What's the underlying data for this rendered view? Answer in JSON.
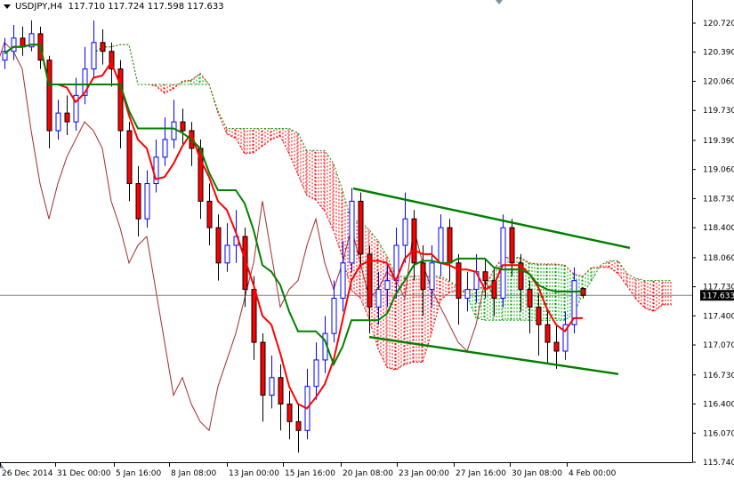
{
  "header": {
    "symbol": "USDJPY,H4",
    "ohlc_text": "117.710 117.724 117.598 117.633"
  },
  "chart_data": {
    "type": "candlestick",
    "title": "USDJPY,H4",
    "current_price": 117.633,
    "current_price_label": "117.633",
    "ylim": [
      115.74,
      120.72
    ],
    "y_ticks": [
      "120.720",
      "120.390",
      "120.060",
      "119.730",
      "119.390",
      "119.060",
      "118.730",
      "118.400",
      "118.060",
      "117.730",
      "117.400",
      "117.070",
      "116.730",
      "116.400",
      "116.070",
      "115.740"
    ],
    "x_ticks": [
      "26 Dec 2014",
      "31 Dec 00:00",
      "5 Jan 16:00",
      "8 Jan 08:00",
      "13 Jan 00:00",
      "15 Jan 16:00",
      "20 Jan 08:00",
      "23 Jan 00:00",
      "27 Jan 16:00",
      "30 Jan 08:00",
      "4 Feb 00:00"
    ],
    "candles_ohlc": [
      [
        120.3,
        120.55,
        120.2,
        120.4
      ],
      [
        120.4,
        120.7,
        120.3,
        120.55
      ],
      [
        120.55,
        120.68,
        120.35,
        120.45
      ],
      [
        120.45,
        120.75,
        120.4,
        120.6
      ],
      [
        120.6,
        120.68,
        120.2,
        120.3
      ],
      [
        120.3,
        120.35,
        119.3,
        119.5
      ],
      [
        119.5,
        119.85,
        119.4,
        119.7
      ],
      [
        119.7,
        119.9,
        119.45,
        119.6
      ],
      [
        119.6,
        120.1,
        119.5,
        119.9
      ],
      [
        119.9,
        120.45,
        119.8,
        120.2
      ],
      [
        120.2,
        120.75,
        120.1,
        120.5
      ],
      [
        120.5,
        120.65,
        120.25,
        120.4
      ],
      [
        120.4,
        120.5,
        120.0,
        120.2
      ],
      [
        120.2,
        120.3,
        119.3,
        119.5
      ],
      [
        119.5,
        119.6,
        118.7,
        118.9
      ],
      [
        118.9,
        119.1,
        118.3,
        118.5
      ],
      [
        118.5,
        119.05,
        118.4,
        118.9
      ],
      [
        118.9,
        119.4,
        118.8,
        119.2
      ],
      [
        119.2,
        119.65,
        119.1,
        119.4
      ],
      [
        119.4,
        119.85,
        119.3,
        119.6
      ],
      [
        119.6,
        119.75,
        119.35,
        119.5
      ],
      [
        119.5,
        119.6,
        119.1,
        119.3
      ],
      [
        119.3,
        119.4,
        118.5,
        118.7
      ],
      [
        118.7,
        118.9,
        118.2,
        118.4
      ],
      [
        118.4,
        118.55,
        117.8,
        118.0
      ],
      [
        118.0,
        118.45,
        117.9,
        118.2
      ],
      [
        118.2,
        118.6,
        118.0,
        118.3
      ],
      [
        118.3,
        118.4,
        117.5,
        117.7
      ],
      [
        117.7,
        117.85,
        116.9,
        117.1
      ],
      [
        117.1,
        117.2,
        116.2,
        116.5
      ],
      [
        116.5,
        116.95,
        116.35,
        116.7
      ],
      [
        116.7,
        116.85,
        116.1,
        116.4
      ],
      [
        116.4,
        116.55,
        116.0,
        116.2
      ],
      [
        116.2,
        116.4,
        115.85,
        116.1
      ],
      [
        116.1,
        116.8,
        116.0,
        116.6
      ],
      [
        116.6,
        117.1,
        116.45,
        116.9
      ],
      [
        116.9,
        117.4,
        116.75,
        117.2
      ],
      [
        117.2,
        117.8,
        117.1,
        117.6
      ],
      [
        117.6,
        118.25,
        117.45,
        118.0
      ],
      [
        118.0,
        118.85,
        117.9,
        118.7
      ],
      [
        118.7,
        118.8,
        117.95,
        118.1
      ],
      [
        118.1,
        118.2,
        117.2,
        117.5
      ],
      [
        117.5,
        117.9,
        117.3,
        117.7
      ],
      [
        117.7,
        118.0,
        117.5,
        117.8
      ],
      [
        117.8,
        118.4,
        117.6,
        118.2
      ],
      [
        118.2,
        118.8,
        118.0,
        118.5
      ],
      [
        118.5,
        118.6,
        117.8,
        118.0
      ],
      [
        118.0,
        118.2,
        117.4,
        117.7
      ],
      [
        117.7,
        118.2,
        117.5,
        118.0
      ],
      [
        118.0,
        118.55,
        117.85,
        118.4
      ],
      [
        118.4,
        118.5,
        117.8,
        118.0
      ],
      [
        118.0,
        118.1,
        117.3,
        117.6
      ],
      [
        117.6,
        117.9,
        117.45,
        117.7
      ],
      [
        117.7,
        118.1,
        117.55,
        117.9
      ],
      [
        117.9,
        118.05,
        117.6,
        117.8
      ],
      [
        117.8,
        117.95,
        117.4,
        117.6
      ],
      [
        117.6,
        118.55,
        117.5,
        118.4
      ],
      [
        118.4,
        118.5,
        117.85,
        118.0
      ],
      [
        118.0,
        118.1,
        117.45,
        117.7
      ],
      [
        117.7,
        117.8,
        117.2,
        117.5
      ],
      [
        117.5,
        117.65,
        116.95,
        117.3
      ],
      [
        117.3,
        117.45,
        116.85,
        117.1
      ],
      [
        117.1,
        117.3,
        116.8,
        117.0
      ],
      [
        117.0,
        117.45,
        116.9,
        117.3
      ],
      [
        117.3,
        117.95,
        117.2,
        117.8
      ],
      [
        117.71,
        117.724,
        117.598,
        117.633
      ]
    ],
    "trendlines": [
      {
        "name": "upper-channel",
        "from": {
          "bar": 39.2,
          "price": 118.845
        },
        "to": {
          "bar": 70.3,
          "price": 118.17
        }
      },
      {
        "name": "lower-channel",
        "from": {
          "bar": 41.0,
          "price": 117.16
        },
        "to": {
          "bar": 69.0,
          "price": 116.74
        }
      }
    ],
    "colors": {
      "bull_outline": "#0000ff",
      "bear_body": "#ff0000",
      "bear_outline": "#000000",
      "tenkan": "#ff0000",
      "kijun": "#008000",
      "chikou": "#a52a2a",
      "cloud_up": "#00a000",
      "cloud_down": "#ff0000",
      "trendline": "#008000",
      "price_line": "#808080",
      "axis": "#000000"
    }
  }
}
